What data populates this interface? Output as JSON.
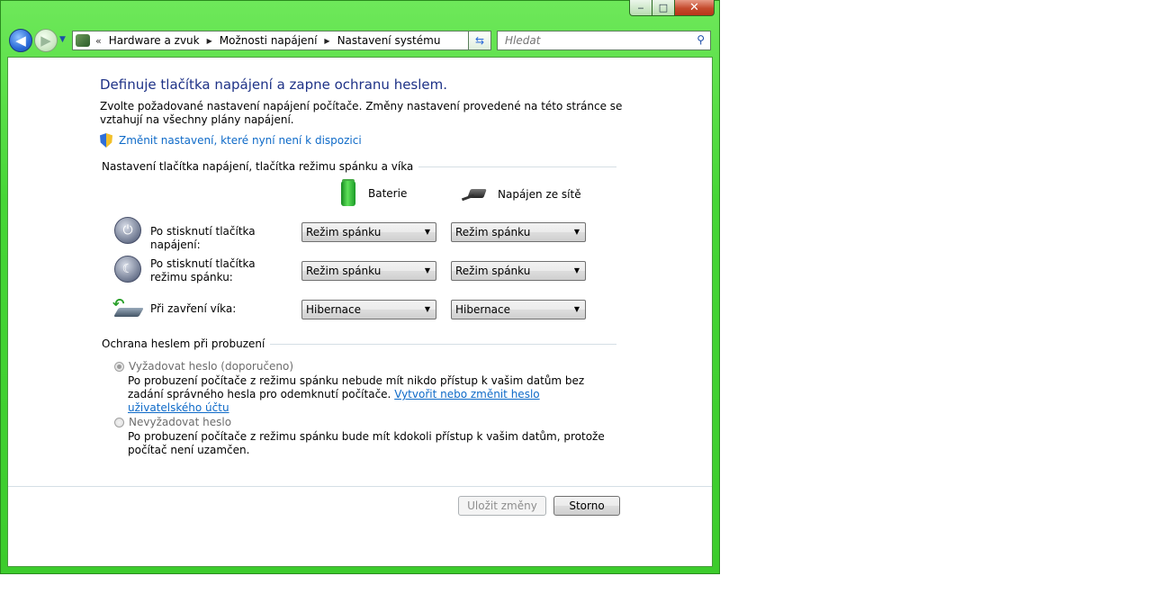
{
  "window": {
    "minimize": "‒",
    "maximize": "□",
    "close": "✕"
  },
  "nav": {
    "back": "◀",
    "forward": "▶",
    "breadcrumb": [
      "Hardware a zvuk",
      "Možnosti napájení",
      "Nastavení systému"
    ],
    "refresh": "⇆",
    "search_placeholder": "Hledat"
  },
  "page": {
    "title": "Definuje tlačítka napájení a zapne ochranu heslem.",
    "description": "Zvolte požadované nastavení napájení počítače. Změny nastavení provedené na této stránce se vztahují na všechny plány napájení.",
    "uac_link": "Změnit nastavení, které nyní není k dispozici"
  },
  "buttons_section": {
    "title": "Nastavení tlačítka napájení, tlačítka režimu spánku a víka",
    "col_battery": "Baterie",
    "col_ac": "Napájen ze sítě",
    "rows": [
      {
        "label": "Po stisknutí tlačítka napájení:",
        "battery": "Režim spánku",
        "ac": "Režim spánku"
      },
      {
        "label": "Po stisknutí tlačítka režimu spánku:",
        "battery": "Režim spánku",
        "ac": "Režim spánku"
      },
      {
        "label": "Při zavření víka:",
        "battery": "Hibernace",
        "ac": "Hibernace"
      }
    ]
  },
  "password_section": {
    "title": "Ochrana heslem při probuzení",
    "require": {
      "label": "Vyžadovat heslo (doporučeno)",
      "desc": "Po probuzení počítače z režimu spánku nebude mít nikdo přístup k vašim datům bez zadání správného hesla pro odemknutí počítače.",
      "link": "Vytvořit nebo změnit heslo uživatelského účtu",
      "selected": true
    },
    "not_require": {
      "label": "Nevyžadovat heslo",
      "desc": "Po probuzení počítače z režimu spánku bude mít kdokoli přístup k vašim datům, protože počítač není uzamčen.",
      "selected": false
    }
  },
  "footer": {
    "save": "Uložit změny",
    "cancel": "Storno"
  }
}
